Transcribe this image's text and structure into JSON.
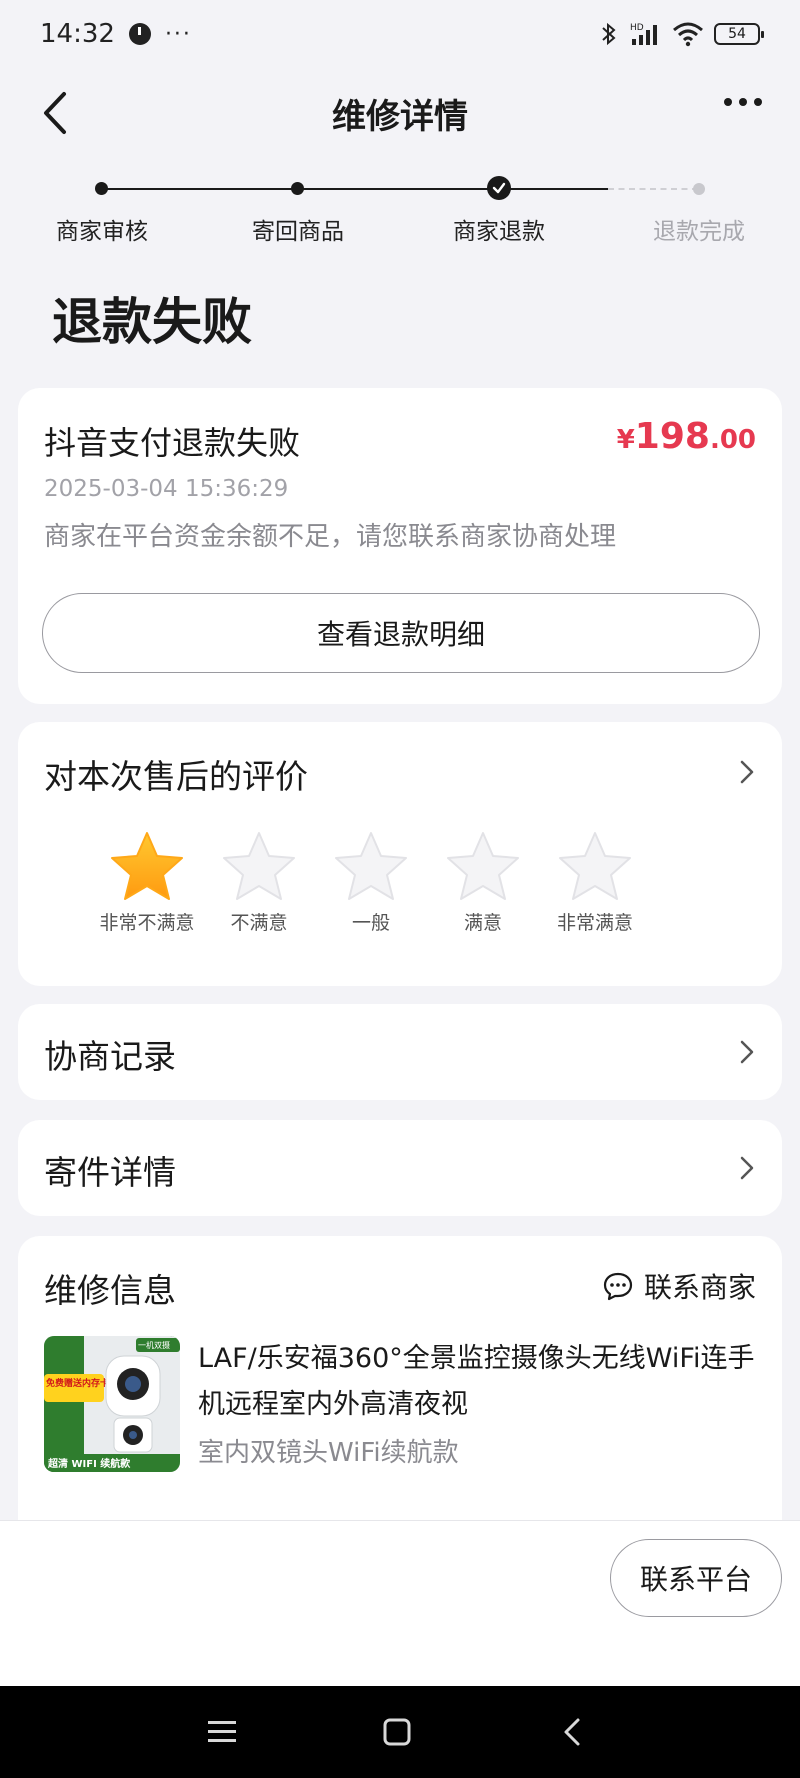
{
  "status_bar": {
    "time": "14:32",
    "more": "···",
    "battery": "54"
  },
  "header": {
    "title": "维修详情"
  },
  "progress": {
    "steps": [
      {
        "label": "商家审核",
        "state": "done"
      },
      {
        "label": "寄回商品",
        "state": "done"
      },
      {
        "label": "商家退款",
        "state": "current"
      },
      {
        "label": "退款完成",
        "state": "pending"
      }
    ]
  },
  "status": {
    "title": "退款失败"
  },
  "refund": {
    "title": "抖音支付退款失败",
    "amount_currency": "¥",
    "amount_int": "198",
    "amount_dec": ".00",
    "time": "2025-03-04 15:36:29",
    "description": "商家在平台资金余额不足，请您联系商家协商处理",
    "detail_button": "查看退款明细"
  },
  "rating": {
    "title": "对本次售后的评价",
    "selected": 1,
    "options": [
      "非常不满意",
      "不满意",
      "一般",
      "满意",
      "非常满意"
    ]
  },
  "negotiation": {
    "title": "协商记录"
  },
  "shipping": {
    "title": "寄件详情"
  },
  "repair": {
    "title": "维修信息",
    "contact_label": "联系商家",
    "product_name": "LAF/乐安福360°全景监控摄像头无线WiFi连手机远程室内外高清夜视",
    "product_spec": "室内双镜头WiFi续航款",
    "thumb_badge": "一机双摄",
    "thumb_promo": "免费赠送内存卡",
    "thumb_footer": "超清 WIFI 续航款"
  },
  "bottom": {
    "platform_button": "联系平台"
  },
  "colors": {
    "accent_red": "#e63950",
    "star_gold": "#ffb020",
    "page_bg": "#f3f3f7"
  }
}
